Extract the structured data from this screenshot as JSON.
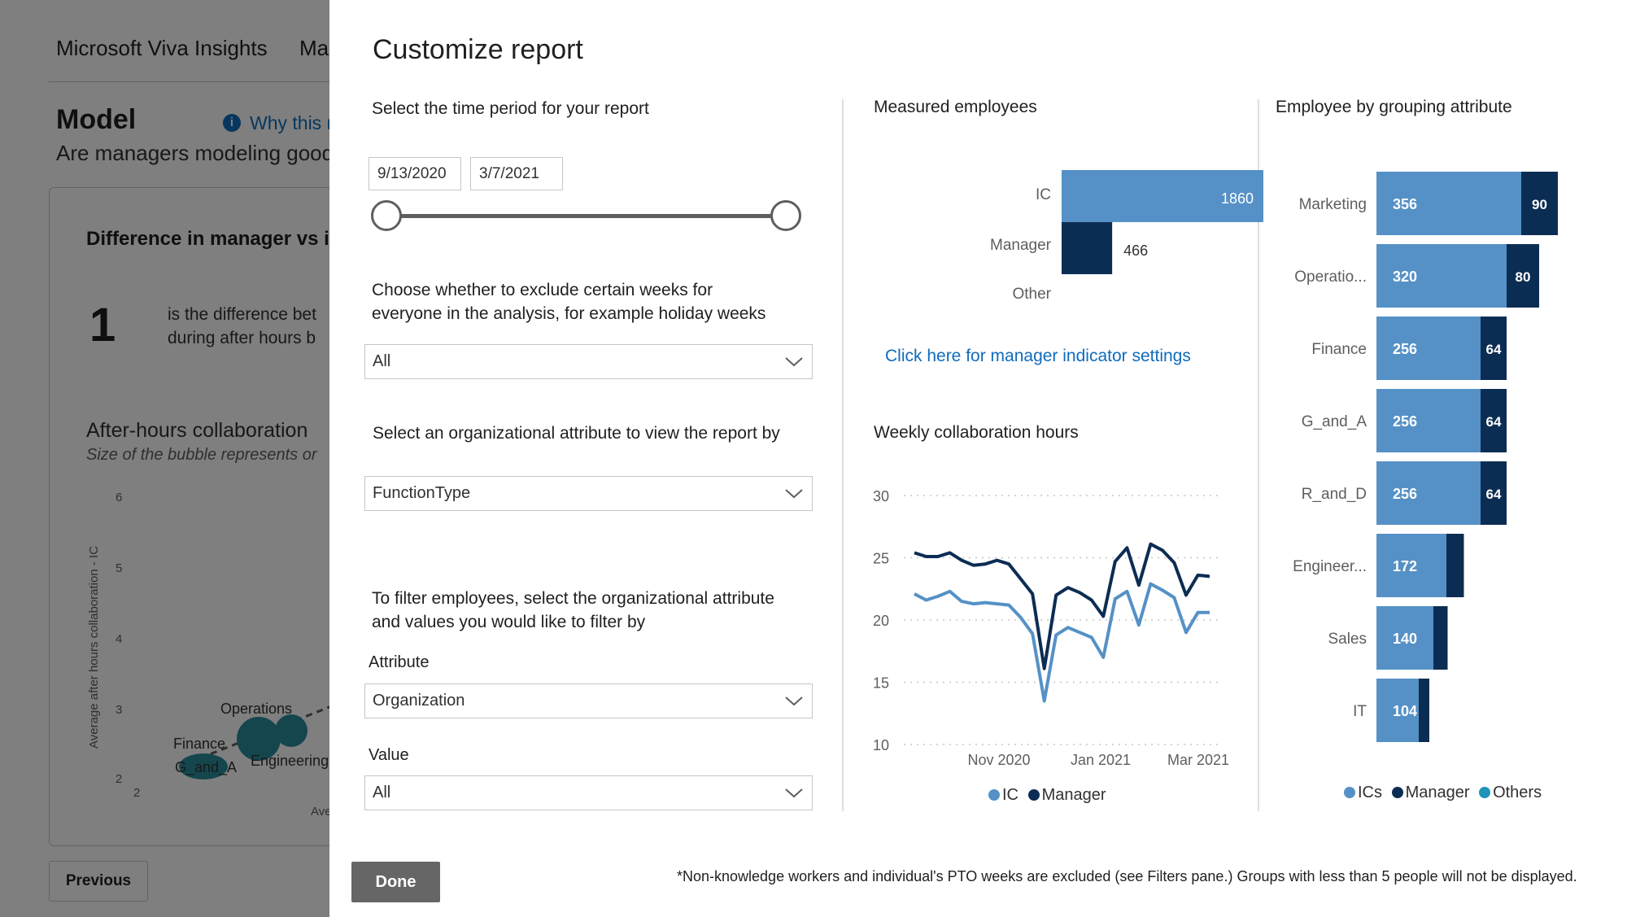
{
  "background": {
    "app_title": "Microsoft Viva Insights",
    "tab_partial": "Ma",
    "page_title": "Model",
    "why_link": "Why this r",
    "subtitle": "Are managers modeling good",
    "card_title": "Difference in manager vs i",
    "metric_value": "1",
    "metric_desc_line1": "is the difference bet",
    "metric_desc_line2": "during after hours b",
    "chart_title": "After-hours collaboration",
    "chart_subtitle": "Size of the bubble represents or",
    "y_axis_label": "Average after hours collaboration - IC",
    "y_ticks": [
      "6",
      "5",
      "4",
      "3",
      "2"
    ],
    "x_tick": "2",
    "x_axis_partial": "Ave",
    "bubble_labels": [
      "Operations",
      "Finance",
      "G_and_A",
      "Engineering"
    ],
    "previous_label": "Previous",
    "bubble_color": "#2a8c9c"
  },
  "dialog": {
    "title": "Customize report",
    "time_period_label": "Select the time period for your report",
    "start_date": "9/13/2020",
    "end_date": "3/7/2021",
    "exclude_label_line1": "Choose whether to exclude certain weeks for",
    "exclude_label_line2": "everyone in the analysis, for example holiday weeks",
    "exclude_value": "All",
    "org_attr_label": "Select an organizational attribute to view the report by",
    "org_attr_value": "FunctionType",
    "filter_label_line1": "To filter employees, select the organizational attribute",
    "filter_label_line2": "and values you would like to filter by",
    "attribute_label": "Attribute",
    "attribute_value": "Organization",
    "value_label": "Value",
    "value_value": "All",
    "done_label": "Done",
    "footnote": "*Non-knowledge workers and individual's PTO weeks are excluded (see Filters pane.) Groups with less than 5 people will not be displayed.",
    "manager_link": "Click here for manager indicator settings"
  },
  "colors": {
    "ic": "#5591c6",
    "manager": "#0c2d53",
    "others": "#1f93b9",
    "link": "#0f6cbd",
    "done_button": "#666666"
  },
  "chart_data": [
    {
      "type": "bar",
      "title": "Measured employees",
      "categories": [
        "IC",
        "Manager",
        "Other"
      ],
      "series": [
        {
          "name": "IC",
          "values": [
            1860,
            null,
            null
          ]
        },
        {
          "name": "Manager",
          "values": [
            null,
            466,
            null
          ]
        }
      ],
      "data_labels": [
        "1860",
        "466"
      ]
    },
    {
      "type": "line",
      "title": "Weekly collaboration hours",
      "x_ticks": [
        "Nov 2020",
        "Jan 2021",
        "Mar 2021"
      ],
      "y_ticks": [
        "30",
        "25",
        "20",
        "15",
        "10"
      ],
      "ylim": [
        10,
        30
      ],
      "grid": true,
      "series": [
        {
          "name": "IC",
          "values": [
            22.1,
            21.6,
            21.9,
            22.3,
            21.5,
            21.3,
            21.4,
            21.3,
            21.2,
            20.2,
            18.9,
            13.5,
            18.8,
            19.4,
            19.0,
            18.6,
            17.0,
            21.7,
            22.3,
            19.6,
            22.9,
            22.4,
            21.8,
            19.0,
            20.6,
            20.6
          ]
        },
        {
          "name": "Manager",
          "values": [
            25.4,
            25.1,
            25.1,
            25.4,
            24.8,
            24.4,
            24.5,
            24.8,
            24.5,
            23.3,
            22.1,
            16.1,
            22.0,
            22.6,
            22.2,
            21.6,
            20.3,
            24.7,
            25.8,
            22.8,
            26.1,
            25.6,
            24.6,
            22.0,
            23.6,
            23.5
          ]
        }
      ],
      "legend": [
        "IC",
        "Manager"
      ]
    },
    {
      "type": "bar",
      "title": "Employee by grouping attribute",
      "categories": [
        "Marketing",
        "Operatio...",
        "Finance",
        "G_and_A",
        "R_and_D",
        "Engineer...",
        "Sales",
        "IT"
      ],
      "series": [
        {
          "name": "ICs",
          "values": [
            356,
            320,
            256,
            256,
            256,
            172,
            140,
            104
          ]
        },
        {
          "name": "Manager",
          "values": [
            90,
            80,
            64,
            64,
            64,
            43,
            35,
            26
          ]
        }
      ],
      "data_labels_ic": [
        "356",
        "320",
        "256",
        "256",
        "256",
        "172",
        "140",
        "104"
      ],
      "data_labels_manager": [
        "90",
        "80",
        "64",
        "64",
        "64",
        "",
        "",
        ""
      ],
      "legend": [
        "ICs",
        "Manager",
        "Others"
      ]
    }
  ]
}
